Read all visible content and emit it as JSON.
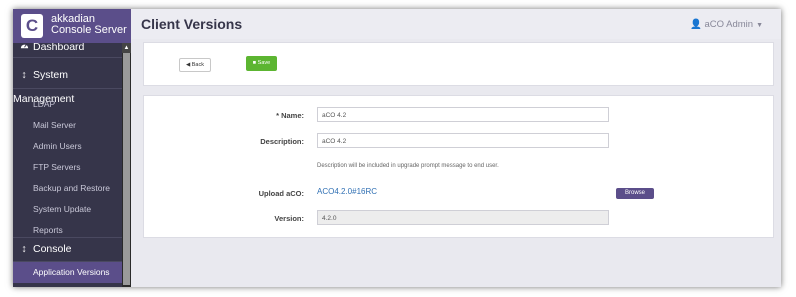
{
  "brand": {
    "logo_letter": "C",
    "line1": "akkadian",
    "line2": "Console Server"
  },
  "sidebar": {
    "items": [
      {
        "label": "Dashboard",
        "icon": "dashboard-icon",
        "type": "head"
      },
      {
        "label": "System Management",
        "icon": "updown-arrow-icon",
        "type": "head"
      },
      {
        "label": "LDAP",
        "type": "sub"
      },
      {
        "label": "Mail Server",
        "type": "sub"
      },
      {
        "label": "Admin Users",
        "type": "sub"
      },
      {
        "label": "FTP Servers",
        "type": "sub"
      },
      {
        "label": "Backup and Restore",
        "type": "sub"
      },
      {
        "label": "System Update",
        "type": "sub"
      },
      {
        "label": "Reports",
        "type": "sub"
      },
      {
        "label": "Console Management",
        "icon": "updown-arrow-icon",
        "type": "head"
      },
      {
        "label": "Application Versions",
        "type": "sub",
        "active": true
      }
    ]
  },
  "header": {
    "title": "Client Versions",
    "user": "aCO Admin"
  },
  "toolbar": {
    "back_label": "Back",
    "save_label": "Save"
  },
  "form": {
    "name_label": "* Name:",
    "name_value": "aCO 4.2",
    "description_label": "Description:",
    "description_value": "aCO 4.2",
    "description_hint": "Description will be included in upgrade prompt message to end user.",
    "upload_label": "Upload aCO:",
    "upload_file": "ACO4.2.0#16RC",
    "browse_label": "Browse",
    "version_label": "Version:",
    "version_value": "4.2.0"
  },
  "colors": {
    "brand": "#5b4e8a",
    "sidebar": "#36354a",
    "save": "#5cb531",
    "link": "#2f6fb3"
  }
}
